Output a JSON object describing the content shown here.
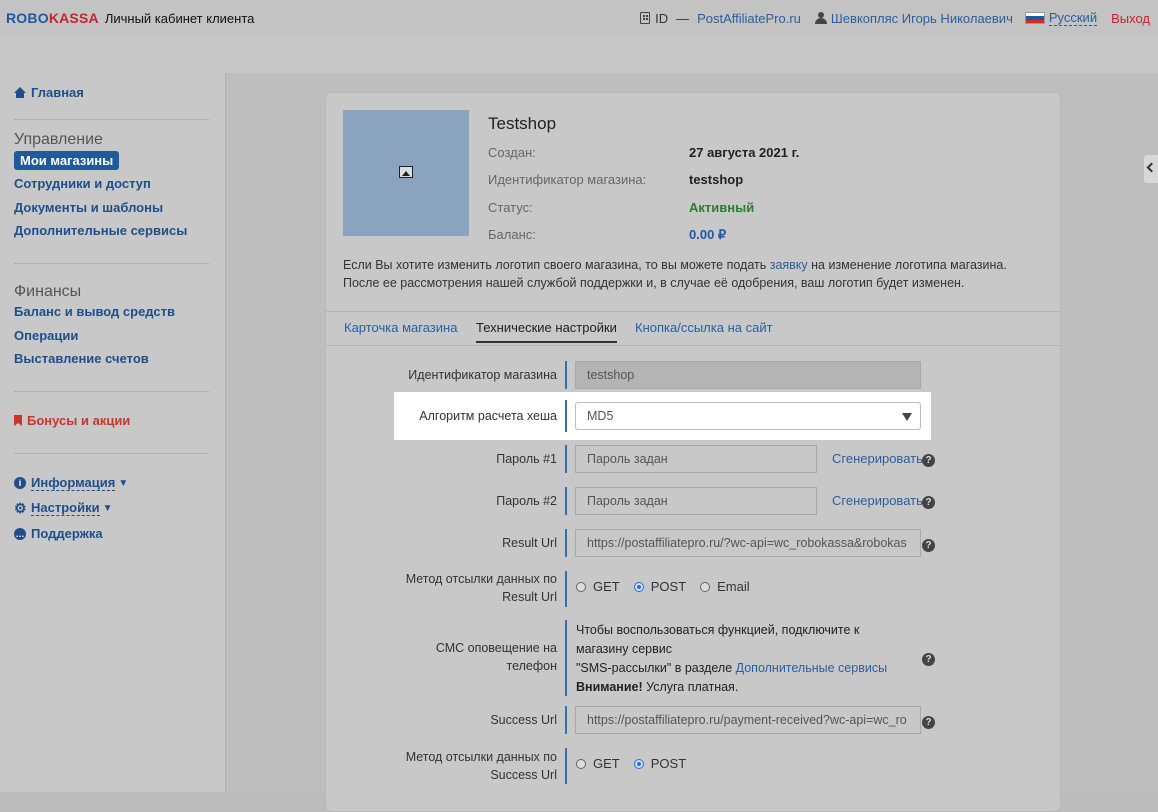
{
  "header": {
    "logo_robo": "ROBO",
    "logo_kassa": "KASSA",
    "cabinet_title": "Личный кабинет клиента",
    "id_label": "ID",
    "id_dash": "—",
    "shop_link": "PostAffiliatePro.ru",
    "user_name": "Шевкопляс Игорь Николаевич",
    "language": "Русский",
    "logout": "Выход",
    "flag_colors": [
      "#ffffff",
      "#1f58a8",
      "#d52b1e"
    ]
  },
  "sidebar": {
    "home": "Главная",
    "management_title": "Управление",
    "management_items": [
      "Мои магазины",
      "Сотрудники и доступ",
      "Документы и шаблоны",
      "Дополнительные сервисы"
    ],
    "finance_title": "Финансы",
    "finance_items": [
      "Баланс и вывод средств",
      "Операции",
      "Выставление счетов"
    ],
    "bonuses": "Бонусы и акции",
    "info": "Информация",
    "settings": "Настройки",
    "support": "Поддержка"
  },
  "shop": {
    "name": "Testshop",
    "created_label": "Создан:",
    "created_value": "27 августа 2021 г.",
    "id_label": "Идентификатор магазина:",
    "id_value": "testshop",
    "status_label": "Статус:",
    "status_value": "Активный",
    "balance_label": "Баланс:",
    "balance_value": "0.00 ₽",
    "note_part1": "Если Вы хотите изменить логотип своего магазина, то вы можете подать ",
    "note_link": "заявку",
    "note_part2": " на изменение логотипа магазина.",
    "note_line2": "После ее рассмотрения нашей службой поддержки и, в случае её одобрения, ваш логотип будет изменен."
  },
  "tabs": [
    "Карточка магазина",
    "Технические настройки",
    "Кнопка/ссылка на сайт"
  ],
  "form": {
    "shop_id_label": "Идентификатор магазина",
    "shop_id_value": "testshop",
    "hash_label": "Алгоритм расчета хеша",
    "hash_value": "MD5",
    "password1_label": "Пароль #1",
    "password1_placeholder": "Пароль задан",
    "password2_label": "Пароль #2",
    "password2_placeholder": "Пароль задан",
    "generate": "Сгенерировать",
    "result_url_label": "Result Url",
    "result_url_value": "https://postaffiliatepro.ru/?wc-api=wc_robokassa&robokas",
    "result_method_label_1": "Метод отсылки данных по",
    "result_method_label_2": "Result Url",
    "method_get": "GET",
    "method_post": "POST",
    "method_email": "Email",
    "sms_label_1": "СМС оповещение на",
    "sms_label_2": "телефон",
    "sms_text_1": "Чтобы воспользоваться функцией, подключите к",
    "sms_text_2": "магазину сервис",
    "sms_text_3": "\"SMS-рассылки\" в разделе ",
    "sms_link": "Дополнительные сервисы",
    "sms_warning": "Внимание!",
    "sms_paid": " Услуга платная.",
    "success_url_label": "Success Url",
    "success_url_value": "https://postaffiliatepro.ru/payment-received?wc-api=wc_ro",
    "success_method_label_1": "Метод отсылки данных по",
    "success_method_label_2": "Success Url",
    "help_glyph": "?"
  }
}
